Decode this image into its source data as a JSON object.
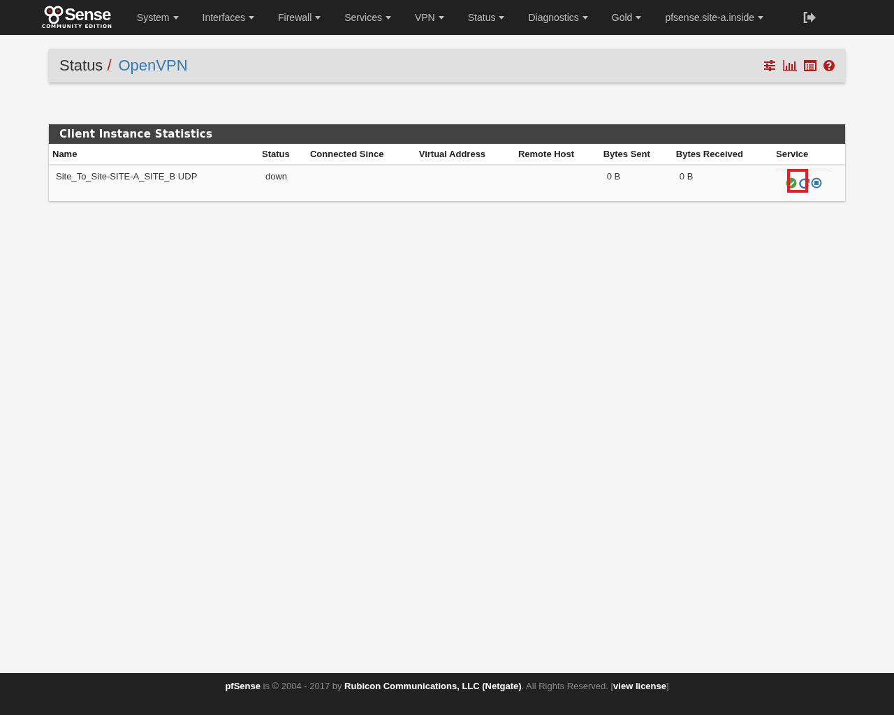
{
  "navbar": {
    "logo": {
      "word": "Sense",
      "edition": "COMMUNITY EDITION"
    },
    "menus": [
      "System",
      "Interfaces",
      "Firewall",
      "Services",
      "VPN",
      "Status",
      "Diagnostics",
      "Gold",
      "pfsense.site-a.inside"
    ]
  },
  "breadcrumb": {
    "section": "Status",
    "separator": "/",
    "page": "OpenVPN"
  },
  "panel": {
    "title": "Client Instance Statistics",
    "columns": [
      "Name",
      "Status",
      "Connected Since",
      "Virtual Address",
      "Remote Host",
      "Bytes Sent",
      "Bytes Received",
      "Service"
    ],
    "rows": [
      {
        "name": "Site_To_Site-SITE-A_SITE_B UDP",
        "status": "down",
        "bytes_sent": "0 B",
        "bytes_received": "0 B",
        "restart_highlighted": true
      }
    ]
  },
  "footer": {
    "text": "**pfSense** is © 2004 - 2017 by **Rubicon Communications, LLC (Netgate)**. All Rights Reserved. [",
    "link": "view license",
    "after": "]"
  }
}
